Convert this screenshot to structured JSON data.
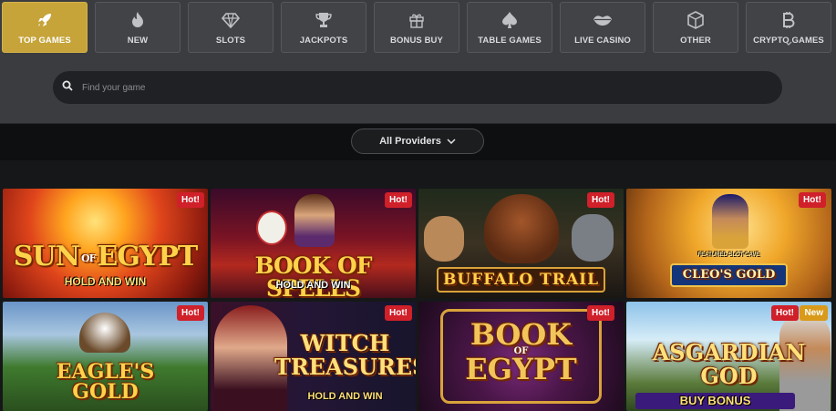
{
  "tabs": [
    {
      "label": "TOP GAMES",
      "icon": "rocket-icon",
      "active": true
    },
    {
      "label": "NEW",
      "icon": "flame-icon"
    },
    {
      "label": "SLOTS",
      "icon": "diamond-icon"
    },
    {
      "label": "JACKPOTS",
      "icon": "trophy-icon"
    },
    {
      "label": "BONUS BUY",
      "icon": "gift-icon"
    },
    {
      "label": "TABLE GAMES",
      "icon": "spade-icon"
    },
    {
      "label": "LIVE CASINO",
      "icon": "lips-icon"
    },
    {
      "label": "OTHER",
      "icon": "cube-icon"
    },
    {
      "label": "CRYPTO GAMES",
      "icon": "bitcoin-icon"
    }
  ],
  "search": {
    "placeholder": "Find your game"
  },
  "providers": {
    "label": "All Providers"
  },
  "colors": {
    "accent": "#c6a43a",
    "hot": "#d0202a",
    "new": "#d99a1a"
  },
  "games": [
    {
      "title_line1": "SUN",
      "title_of": "OF",
      "title_line2": "EGYPT",
      "subtitle": "HOLD AND WIN",
      "badges": [
        "Hot!"
      ]
    },
    {
      "title_line1": "BOOK OF SPELLS",
      "subtitle": "HOLD AND WIN",
      "badges": [
        "Hot!"
      ]
    },
    {
      "title_line1": "BUFFALO TRAIL",
      "badges": [
        "Hot!"
      ]
    },
    {
      "title_line1": "CLEO'S GOLD",
      "subtitle": "FEATURED SLOT CAVE",
      "badges": [
        "Hot!"
      ]
    },
    {
      "title_line1": "EAGLE'S",
      "title_line2": "GOLD",
      "badges": [
        "Hot!"
      ]
    },
    {
      "title_line1": "WITCH",
      "title_line2": "TREASURES",
      "subtitle": "HOLD AND WIN",
      "badges": [
        "Hot!"
      ]
    },
    {
      "title_line1": "BOOK",
      "title_of": "OF",
      "title_line2": "EGYPT",
      "badges": [
        "Hot!"
      ]
    },
    {
      "title_line1": "ASGARDIAN",
      "title_line2": "GOD",
      "subtitle": "BUY BONUS",
      "badges": [
        "Hot!",
        "New"
      ]
    }
  ]
}
